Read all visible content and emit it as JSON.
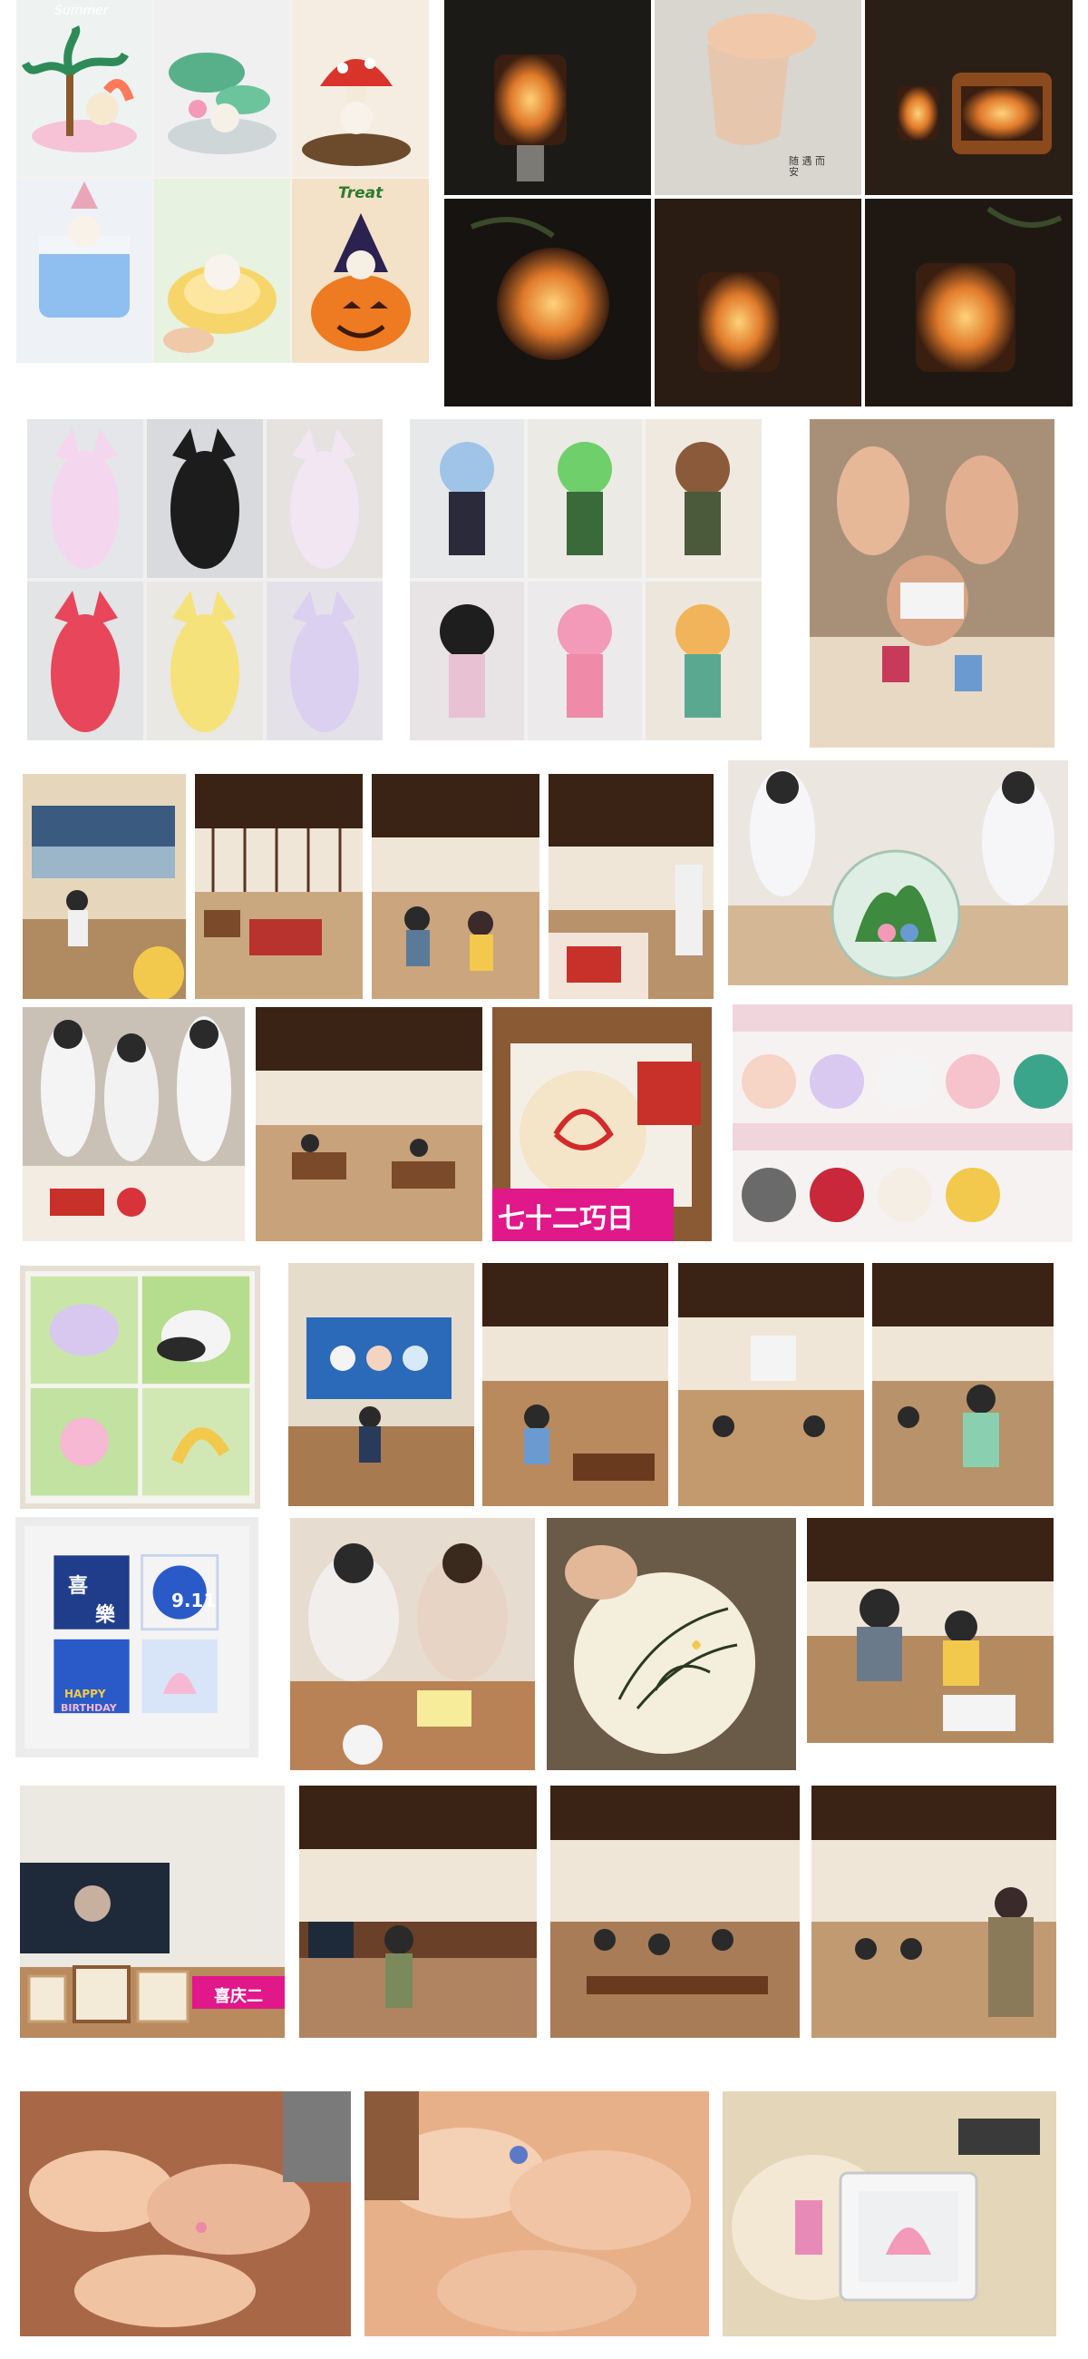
{
  "page": {
    "background": "#ffffff"
  },
  "captions": {
    "summer": "Summer",
    "treat": "Treat",
    "jar_label": "随 遇 而安",
    "banner_row3": "七十二巧日",
    "banner_row5": "喜庆二",
    "frame_top_left": "喜",
    "frame_top_mid": "樂",
    "frame_date": "9.11",
    "frame_happy": "HAPPY",
    "frame_birthday": "BIRTHDAY"
  },
  "palette": {
    "wood": "#7a4a2a",
    "dark_wood": "#4a2a18",
    "candle_glow": "#f0a040",
    "night": "#1a1410",
    "pink_accent": "#e0188a",
    "clay_white": "#f4efe8",
    "mint": "#8fd4a8",
    "navy_frame": "#1f3d8a"
  }
}
